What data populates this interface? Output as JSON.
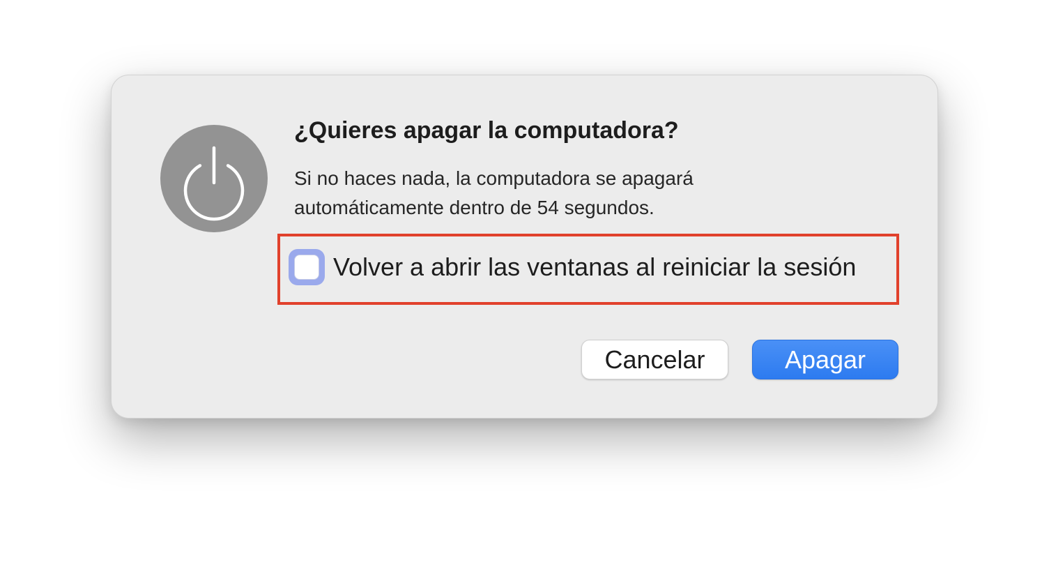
{
  "dialog": {
    "icon": "power-icon",
    "title": "¿Quieres apagar la computadora?",
    "message_line1": "Si no haces nada, la computadora se apagará",
    "message_line2": "automáticamente dentro de 54 segundos.",
    "reopen_windows": {
      "label": "Volver a abrir las ventanas al reiniciar la sesión",
      "checked": false
    },
    "buttons": {
      "cancel_label": "Cancelar",
      "confirm_label": "Apagar"
    }
  },
  "colors": {
    "dialog_background": "#ececec",
    "icon_badge": "#939393",
    "highlight_frame": "#e1412c",
    "primary_button": "#2d7bf0",
    "checkbox_focus_ring": "#9aa9ec"
  }
}
